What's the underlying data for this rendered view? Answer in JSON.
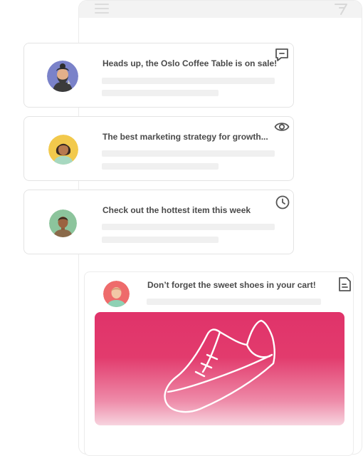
{
  "colors": {
    "accent_pink": "#e0336a",
    "card_border": "#e4e4e4",
    "placeholder": "#f0f0f0",
    "text": "#4a4a4a"
  },
  "background_window": {
    "menu_icon": "hamburger-icon",
    "logo_icon": "brand-logo-icon"
  },
  "notifications": [
    {
      "title": "Heads up, the Oslo Coffee Table is on sale!",
      "icon": "message-icon"
    },
    {
      "title": "The best marketing strategy for growth...",
      "icon": "eye-icon"
    },
    {
      "title": "Check out the hottest item this week",
      "icon": "clock-icon"
    }
  ],
  "featured": {
    "title": "Don’t forget the sweet shoes in your cart!",
    "icon": "document-icon",
    "image_icon": "sneaker-icon"
  }
}
